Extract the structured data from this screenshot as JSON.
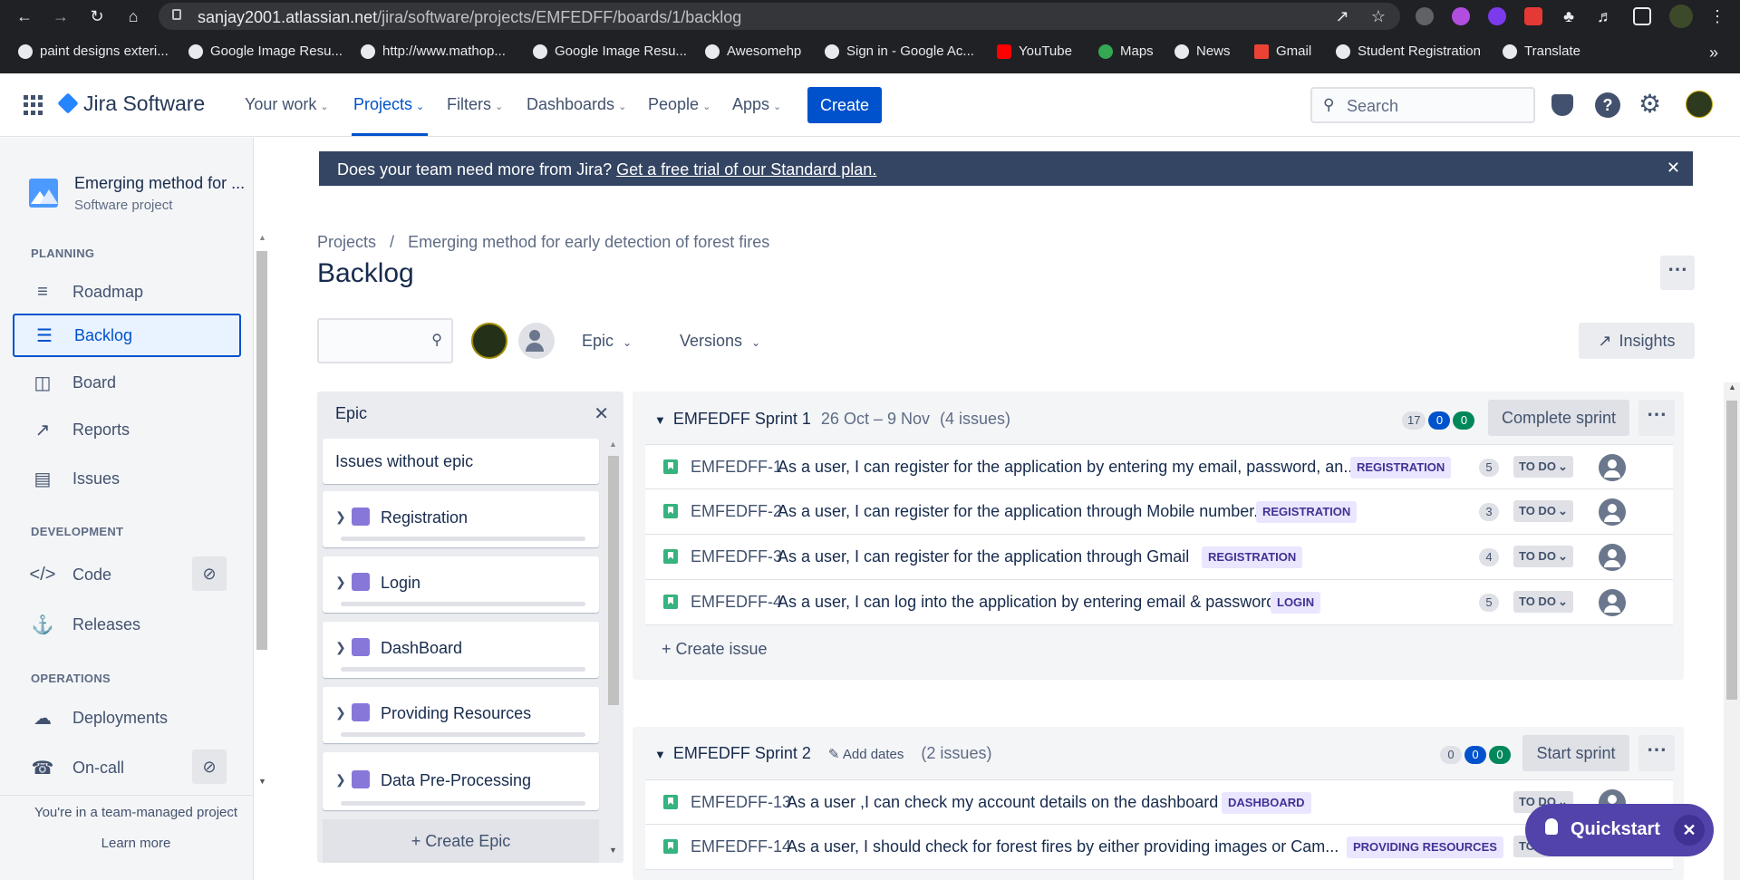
{
  "browser": {
    "url_host": "sanjay2001.atlassian.net",
    "url_path": "/jira/software/projects/EMFEDFF/boards/1/backlog",
    "bookmarks": [
      "paint designs exteri...",
      "Google Image Resu...",
      "http://www.mathop...",
      "Google Image Resu...",
      "Awesomehp",
      "Sign in - Google Ac...",
      "YouTube",
      "Maps",
      "News",
      "Gmail",
      "Student Registration",
      "Translate"
    ]
  },
  "topnav": {
    "logo": "Jira Software",
    "items": [
      "Your work",
      "Projects",
      "Filters",
      "Dashboards",
      "People",
      "Apps"
    ],
    "create": "Create",
    "search_placeholder": "Search"
  },
  "sidebar": {
    "project_name": "Emerging method for ...",
    "project_type": "Software project",
    "planning_label": "PLANNING",
    "planning": [
      "Roadmap",
      "Backlog",
      "Board",
      "Reports",
      "Issues"
    ],
    "development_label": "DEVELOPMENT",
    "development": [
      "Code",
      "Releases"
    ],
    "operations_label": "OPERATIONS",
    "operations": [
      "Deployments",
      "On-call"
    ],
    "footer": "You're in a team-managed project",
    "learn_more": "Learn more"
  },
  "banner": {
    "text": "Does your team need more from Jira?",
    "link": "Get a free trial of our Standard plan."
  },
  "breadcrumb": {
    "root": "Projects",
    "sep": "/",
    "project": "Emerging method for early detection of forest fires"
  },
  "page_title": "Backlog",
  "filters": {
    "epic": "Epic",
    "versions": "Versions",
    "insights": "Insights"
  },
  "epic_panel": {
    "title": "Epic",
    "without": "Issues without epic",
    "epics": [
      "Registration",
      "Login",
      "DashBoard",
      "Providing Resources",
      "Data Pre-Processing"
    ],
    "create": "+ Create Epic"
  },
  "sprint1": {
    "name": "EMFEDFF Sprint 1",
    "dates": "26 Oct – 9 Nov",
    "count": "(4 issues)",
    "todo": "17",
    "inprogress": "0",
    "done": "0",
    "button": "Complete sprint",
    "issues": [
      {
        "key": "EMFEDFF-1",
        "summary": "As a user, I can register for the application by entering my email, password, an...",
        "epic": "REGISTRATION",
        "points": "5",
        "status": "TO DO"
      },
      {
        "key": "EMFEDFF-2",
        "summary": "As a user, I can register for the application through Mobile number.",
        "epic": "REGISTRATION",
        "points": "3",
        "status": "TO DO"
      },
      {
        "key": "EMFEDFF-3",
        "summary": "As a user, I can register for the application through Gmail",
        "epic": "REGISTRATION",
        "points": "4",
        "status": "TO DO"
      },
      {
        "key": "EMFEDFF-4",
        "summary": "As a user, I can log into the application by entering email & password",
        "epic": "LOGIN",
        "points": "5",
        "status": "TO DO"
      }
    ],
    "create_issue": "+ Create issue"
  },
  "sprint2": {
    "name": "EMFEDFF Sprint 2",
    "add_dates": "Add dates",
    "count": "(2 issues)",
    "todo": "0",
    "inprogress": "0",
    "done": "0",
    "button": "Start sprint",
    "issues": [
      {
        "key": "EMFEDFF-13",
        "summary": "As a user ,I can check my account details on the dashboard",
        "epic": "DASHBOARD",
        "status": "TO DO"
      },
      {
        "key": "EMFEDFF-14",
        "summary": "As a user, I should check for forest fires by either providing images or Cam...",
        "epic": "PROVIDING RESOURCES",
        "status": "TO"
      }
    ]
  },
  "quickstart": "Quickstart"
}
